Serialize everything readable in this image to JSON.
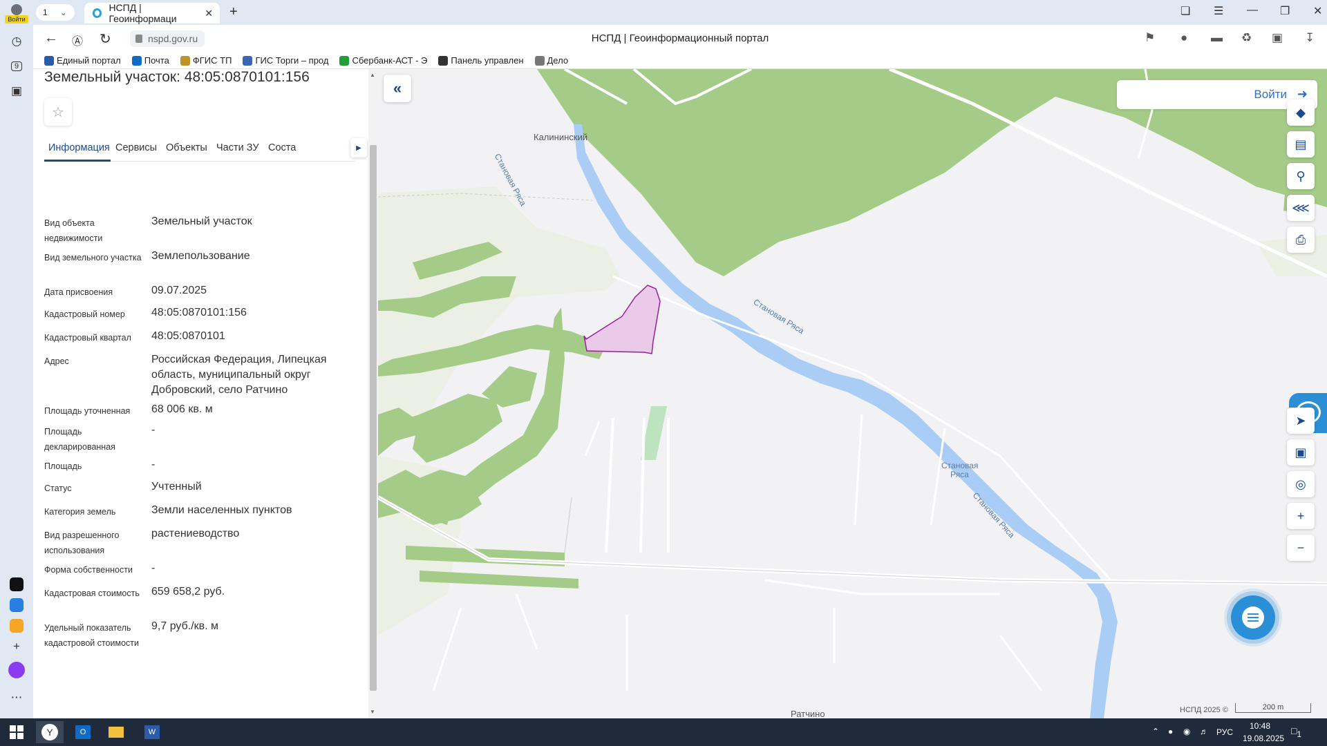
{
  "browser": {
    "account_badge": "Войти",
    "tab_count": "1",
    "tab_title": "НСПД | Геоинформаци",
    "url": "nspd.gov.ru",
    "page_title": "НСПД | Геоинформационный портал",
    "rail_badge": "9",
    "bookmarks": [
      {
        "label": "Единый портал",
        "icon": "gov-portal-icon",
        "color": "#2b5aa8"
      },
      {
        "label": "Почта",
        "icon": "mail-icon",
        "color": "#0e6cc4"
      },
      {
        "label": "ФГИС ТП",
        "icon": "emblem-icon",
        "color": "#c0922a"
      },
      {
        "label": "ГИС Торги – прод",
        "icon": "emblem-icon",
        "color": "#3c66b0"
      },
      {
        "label": "Сбербанк-АСТ - Э",
        "icon": "sber-icon",
        "color": "#21a038"
      },
      {
        "label": "Панель управлен",
        "icon": "fin-icon",
        "color": "#333333"
      },
      {
        "label": "Дело",
        "icon": "document-icon",
        "color": "#777777"
      }
    ]
  },
  "panel": {
    "title": "Земельный участок: 48:05:0870101:156",
    "tabs": [
      "Информация",
      "Сервисы",
      "Объекты",
      "Части ЗУ",
      "Соста"
    ],
    "rows": [
      {
        "key": "Вид объекта недвижимости",
        "value": "Земельный участок"
      },
      {
        "key": "Вид земельного участка",
        "value": "Землепользование"
      },
      {
        "key": "Дата присвоения",
        "value": "09.07.2025"
      },
      {
        "key": "Кадастровый номер",
        "value": "48:05:0870101:156"
      },
      {
        "key": "Кадастровый квартал",
        "value": "48:05:0870101"
      },
      {
        "key": "Адрес",
        "value": "Российская Федерация, Липецкая область, муниципальный округ Добровский, село Ратчино"
      },
      {
        "key": "Площадь уточненная",
        "value": "68 006 кв. м"
      },
      {
        "key": "Площадь декларированная",
        "value": "-"
      },
      {
        "key": "Площадь",
        "value": "-"
      },
      {
        "key": "Статус",
        "value": "Учтенный"
      },
      {
        "key": "Категория земель",
        "value": "Земли населенных пунктов"
      },
      {
        "key": "Вид разрешенного использования",
        "value": "растениеводство"
      },
      {
        "key": "Форма собственности",
        "value": "-"
      },
      {
        "key": "Кадастровая стоимость",
        "value": "659 658,2 руб."
      },
      {
        "key": "Удельный показатель кадастровой стоимости",
        "value": "9,7 руб./кв. м"
      }
    ]
  },
  "map": {
    "login_label": "Войти",
    "labels": {
      "village_kalininsky": "Калининский",
      "village_ratchino": "Ратчино",
      "river_1": "Становая Ряса",
      "river_2": "Становая Ряса",
      "river_3_line1": "Становая",
      "river_3_line2": "Ряса",
      "river_4": "Становая Ряса"
    },
    "copyright": "НСПД 2025 ©",
    "scale": "200 m",
    "colors": {
      "forest": "#a4cc88",
      "water": "#aacdf5",
      "parcel_fill": "#e9cbe9",
      "parcel_stroke": "#9a1d9a",
      "accent": "#1b4a8c"
    }
  },
  "taskbar": {
    "time": "10:48",
    "date": "19.08.2025",
    "lang": "РУС",
    "notifications": "1"
  }
}
